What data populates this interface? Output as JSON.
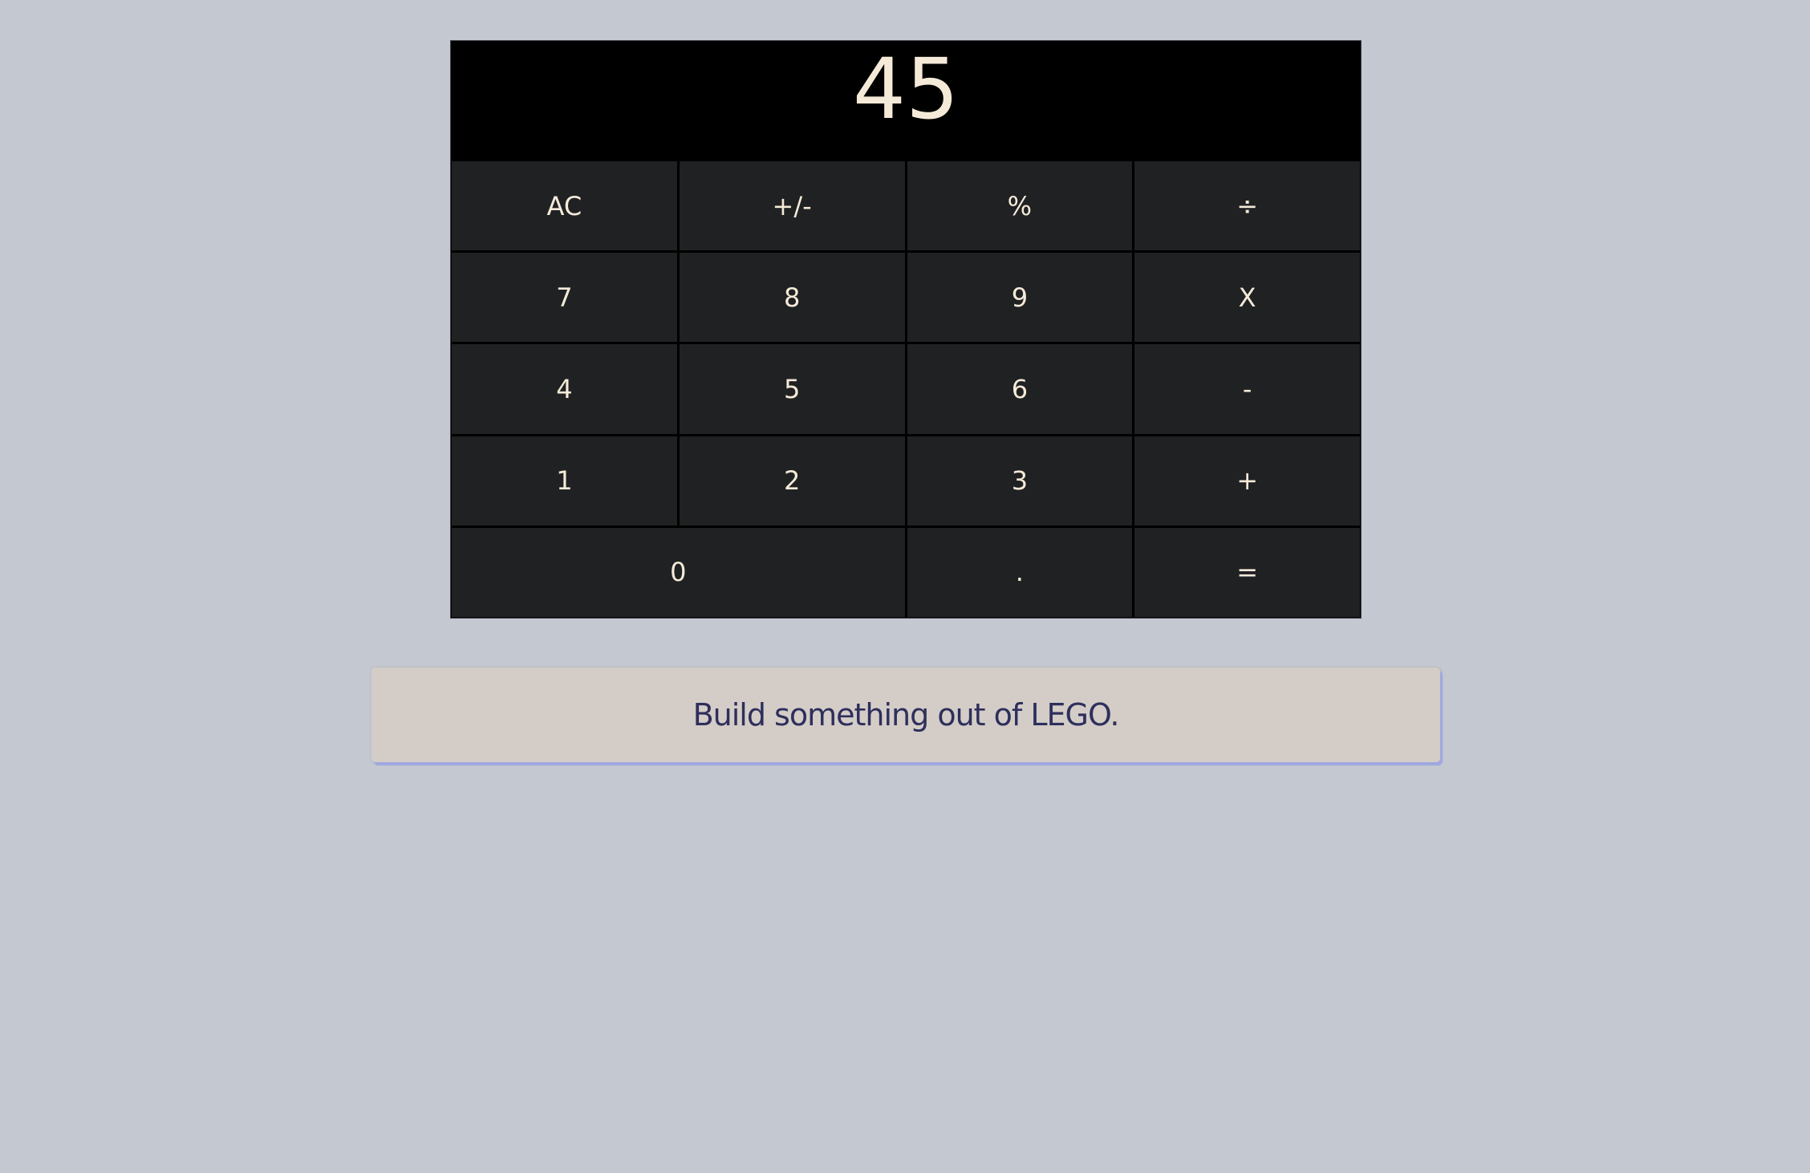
{
  "calculator": {
    "display": "45",
    "keys": [
      {
        "label": "AC",
        "name": "clear-button"
      },
      {
        "label": "+/-",
        "name": "negate-button"
      },
      {
        "label": "%",
        "name": "percent-button"
      },
      {
        "label": "÷",
        "name": "divide-button"
      },
      {
        "label": "7",
        "name": "digit-7-button"
      },
      {
        "label": "8",
        "name": "digit-8-button"
      },
      {
        "label": "9",
        "name": "digit-9-button"
      },
      {
        "label": "X",
        "name": "multiply-button"
      },
      {
        "label": "4",
        "name": "digit-4-button"
      },
      {
        "label": "5",
        "name": "digit-5-button"
      },
      {
        "label": "6",
        "name": "digit-6-button"
      },
      {
        "label": "-",
        "name": "subtract-button"
      },
      {
        "label": "1",
        "name": "digit-1-button"
      },
      {
        "label": "2",
        "name": "digit-2-button"
      },
      {
        "label": "3",
        "name": "digit-3-button"
      },
      {
        "label": "+",
        "name": "add-button"
      },
      {
        "label": "0",
        "name": "digit-0-button"
      },
      {
        "label": ".",
        "name": "decimal-button"
      },
      {
        "label": "=",
        "name": "equals-button"
      }
    ]
  },
  "suggestion": {
    "text": "Build something out of LEGO."
  },
  "colors": {
    "background": "#c4c8d0",
    "display_bg": "#000000",
    "key_bg": "#202123",
    "key_text": "#f5ead8",
    "card_bg": "#d4cdc7",
    "card_text": "#2e2f5c",
    "card_shadow": "#9fa8e0"
  }
}
